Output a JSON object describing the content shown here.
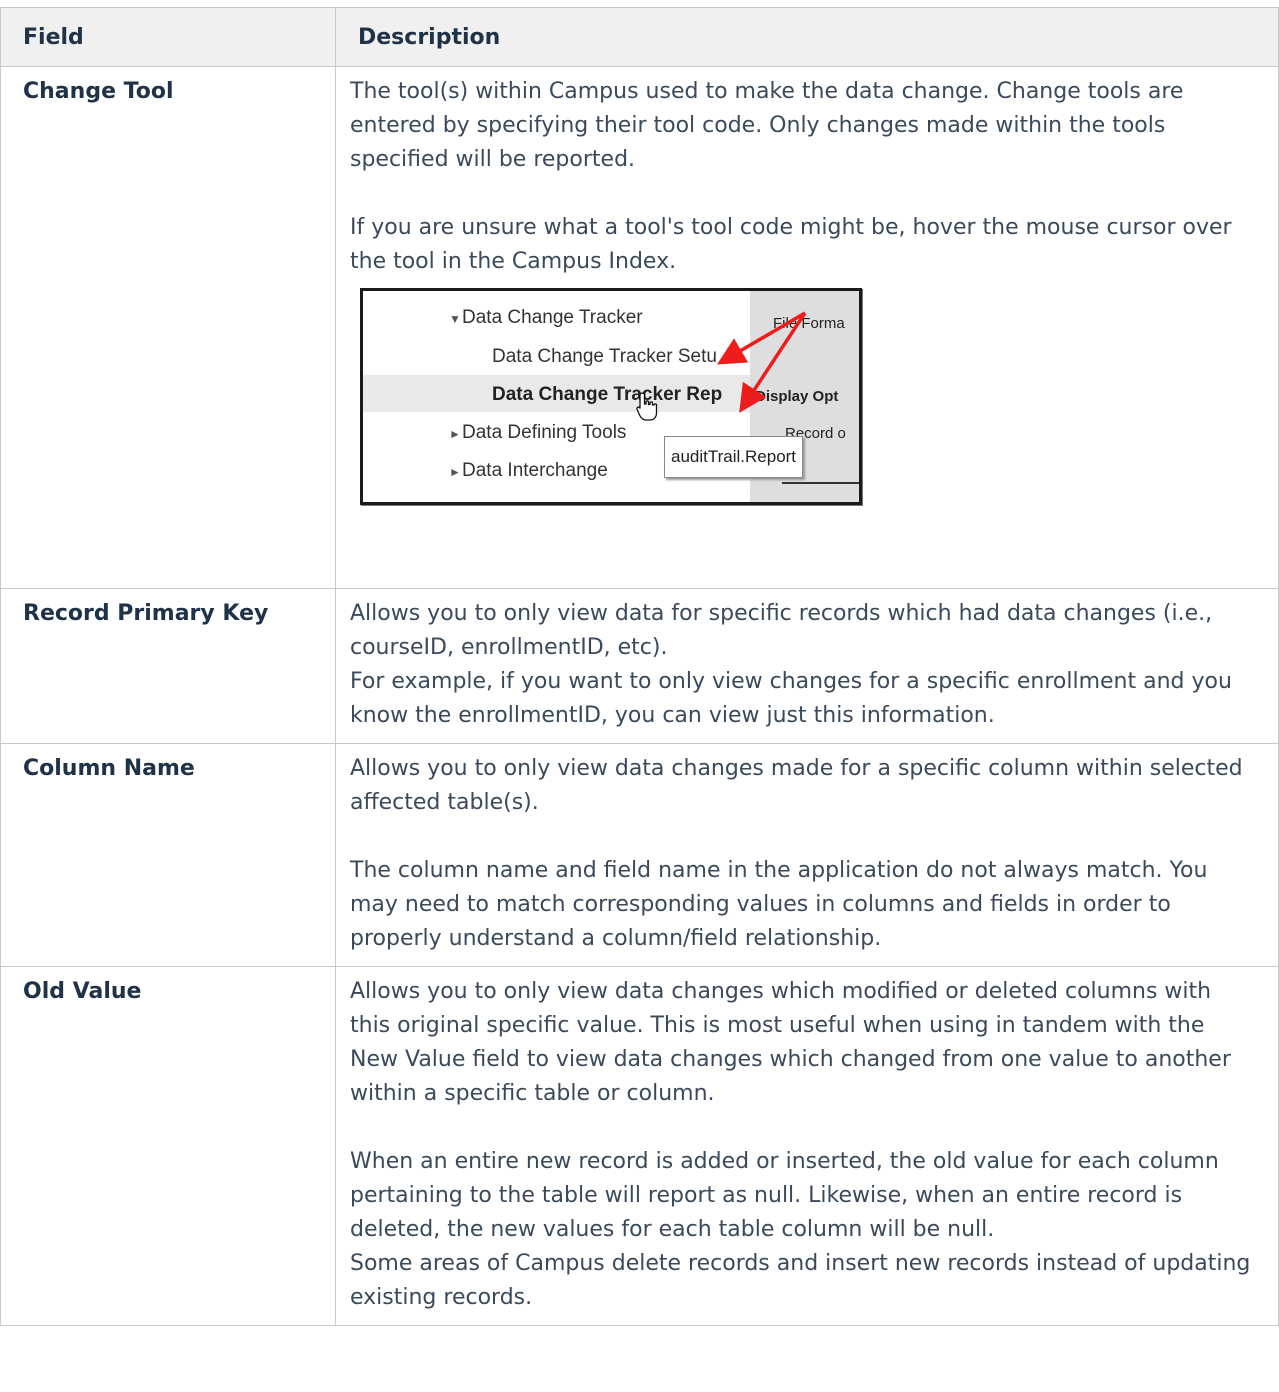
{
  "table": {
    "headers": [
      "Field",
      "Description"
    ],
    "rows": [
      {
        "field": "Change Tool",
        "paragraphs": [
          "The tool(s) within Campus used to make the data change. Change tools are entered by specifying their tool code. Only changes made within the tools specified will be reported.",
          "If you are unsure what a tool's tool code might be, hover the mouse cursor over the tool in the Campus Index."
        ]
      },
      {
        "field": "Record Primary Key",
        "lines": [
          "Allows you to only view data for specific records which had data changes (i.e., courseID, enrollmentID, etc).",
          "For example, if you want to only view changes for a specific enrollment and you know the enrollmentID, you can view just this information."
        ]
      },
      {
        "field": "Column Name",
        "paragraphs": [
          "Allows you to only view data changes made for a specific column within selected affected table(s).",
          "The column name and field name in the application do not always match. You may need to match corresponding values in columns and fields in order to properly understand a column/field relationship."
        ]
      },
      {
        "field": "Old Value",
        "paragraphs": [
          "Allows you to only view data changes which modified or deleted columns with this original specific value. This is most useful when using in tandem with the New Value field to view data changes which changed from one value to another within a specific table or column.",
          "When an entire new record is added or inserted, the old value for each column pertaining to the table will report as null. Likewise, when an entire record is deleted, the new values for each table column will be null.",
          "Some areas of Campus delete records and insert new records instead of updating existing records."
        ]
      }
    ]
  },
  "screenshot": {
    "items": [
      {
        "triangle": "▼",
        "label": "Data Change Tracker"
      },
      {
        "label": "Data Change Tracker Setu"
      },
      {
        "label": "Data Change Tracker Rep"
      },
      {
        "triangle": "►",
        "label": "Data Defining Tools"
      },
      {
        "triangle": "►",
        "label": "Data Interchange"
      }
    ],
    "right_labels": [
      "File Forma",
      "Display Opt",
      "Record o"
    ],
    "tooltip": "auditTrail.Report",
    "arrow_color": "#ee1c1c"
  }
}
